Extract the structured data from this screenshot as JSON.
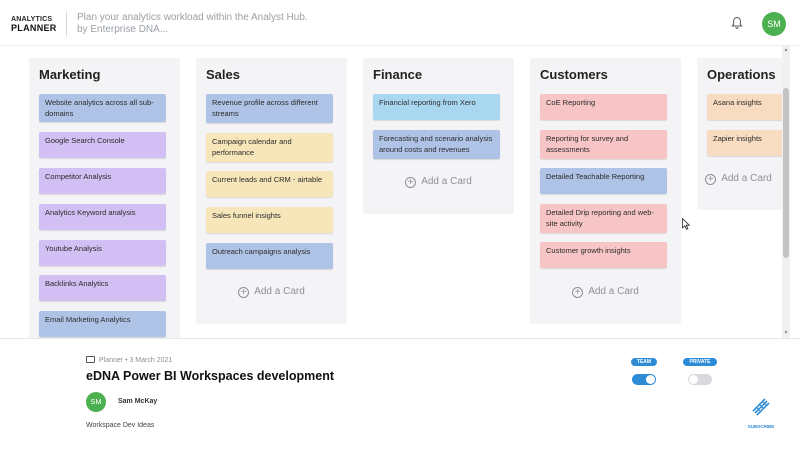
{
  "header": {
    "logo_line1": "ANALYTICS",
    "logo_line2": "PLANNER",
    "tagline_line1": "Plan your analytics workload within the Analyst Hub.",
    "tagline_line2": "by Enterprise DNA...",
    "avatar_initials": "SM"
  },
  "board": {
    "add_card_label": "Add a Card",
    "columns": [
      {
        "title": "Marketing",
        "cards": [
          {
            "text": "Website analytics across all sub-domains",
            "color": "#aec3e6"
          },
          {
            "text": "Google Search Console",
            "color": "#d2bff3"
          },
          {
            "text": "Competitor Analysis",
            "color": "#d2bff3"
          },
          {
            "text": "Analytics Keyword analysis",
            "color": "#d2bff3"
          },
          {
            "text": "Youtube Analysis",
            "color": "#d2bff3"
          },
          {
            "text": "Backlinks Analytics",
            "color": "#d2bff3"
          },
          {
            "text": "Email Marketing Analytics",
            "color": "#aec3e6"
          }
        ]
      },
      {
        "title": "Sales",
        "cards": [
          {
            "text": "Revenue profile across different streams",
            "color": "#aec3e6"
          },
          {
            "text": "Campaign calendar and performance",
            "color": "#f6e6b9"
          },
          {
            "text": "Current leads and CRM - airtable",
            "color": "#f6e6b9"
          },
          {
            "text": "Sales funnel insights",
            "color": "#f6e6b9"
          },
          {
            "text": "Outreach campaigns analysis",
            "color": "#aec3e6"
          }
        ]
      },
      {
        "title": "Finance",
        "cards": [
          {
            "text": "Financial reporting from Xero",
            "color": "#a9d7f0"
          },
          {
            "text": "Forecasting and scenario analysis around costs and revenues",
            "color": "#aec3e6"
          }
        ]
      },
      {
        "title": "Customers",
        "cards": [
          {
            "text": "CoE Reporting",
            "color": "#f7c5c5"
          },
          {
            "text": "Reporting for survey and assessments",
            "color": "#f7c5c5"
          },
          {
            "text": "Detailed Teachable Reporting",
            "color": "#aec3e6"
          },
          {
            "text": "Detailed Drip reporting and web-site activity",
            "color": "#f7c5c5"
          },
          {
            "text": "Customer growth insights",
            "color": "#f7c5c5"
          }
        ]
      },
      {
        "title": "Operations",
        "cards": [
          {
            "text": "Asana insights",
            "color": "#f8dcc1"
          },
          {
            "text": "Zapier insights",
            "color": "#f8dcc1"
          }
        ]
      }
    ]
  },
  "footer": {
    "meta": "Planner • 3 March 2021",
    "title": "eDNA Power BI Workspaces development",
    "author_initials": "SM",
    "author": "Sam McKay",
    "description": "Workspace Dev Ideas",
    "team_badge": "TEAM",
    "private_badge": "PRIVATE",
    "team_enabled": true,
    "private_enabled": false,
    "subscribe_label": "SUBSCRIBE"
  }
}
